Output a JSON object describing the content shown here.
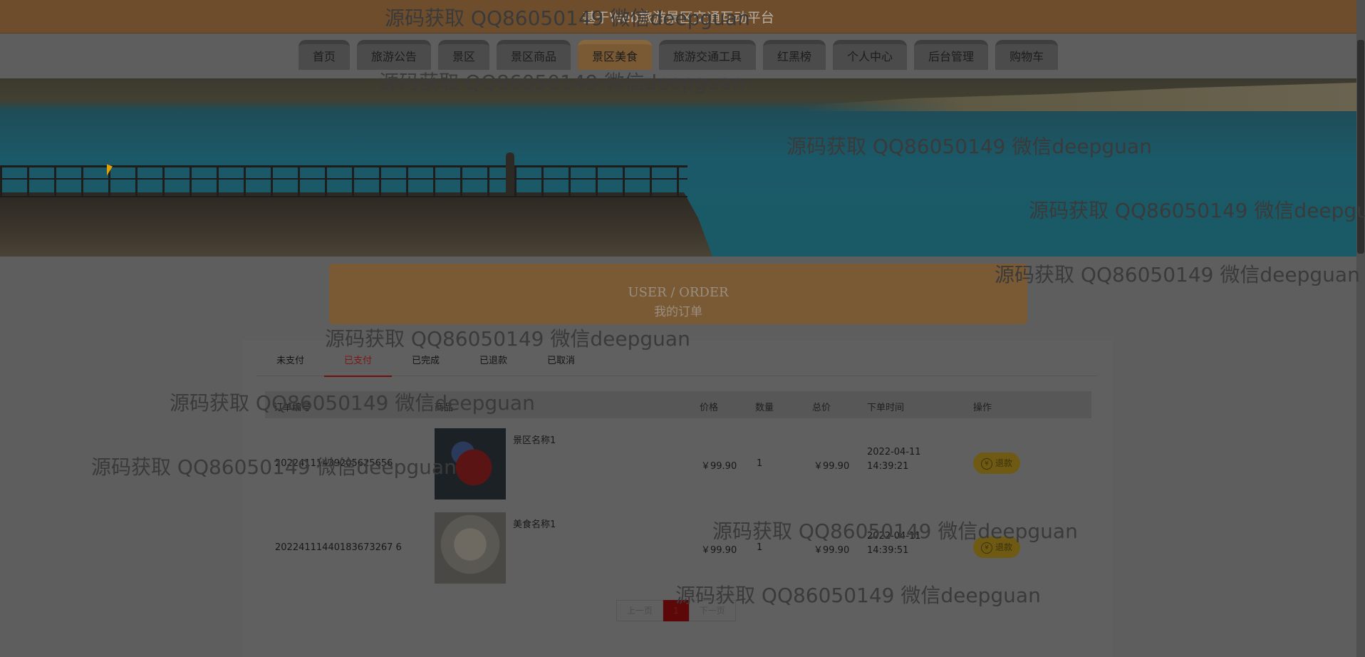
{
  "site_title": "基于Web旅游景区交通互动平台",
  "nav": [
    "首页",
    "旅游公告",
    "景区",
    "景区商品",
    "景区美食",
    "旅游交通工具",
    "红黑榜",
    "个人中心",
    "后台管理",
    "购物车"
  ],
  "nav_active": "景区美食",
  "order_header": {
    "en": "USER / ORDER",
    "zh": "我的订单"
  },
  "tabs": [
    "未支付",
    "已支付",
    "已完成",
    "已退款",
    "已取消"
  ],
  "tab_active": "已支付",
  "columns": [
    "订单编号",
    "商品",
    "价格",
    "数量",
    "总价",
    "下单时间",
    "操作"
  ],
  "orders": [
    {
      "order_no": "20224111439205625656",
      "name": "景区名称1",
      "price": "￥99.90",
      "qty": "1",
      "total": "￥99.90",
      "time_date": "2022-04-11",
      "time_clock": "14:39:21",
      "action": "退款"
    },
    {
      "order_no": "20224111440183673267 6",
      "name": "美食名称1",
      "price": "￥99.90",
      "qty": "1",
      "total": "￥99.90",
      "time_date": "2022-04-11",
      "time_clock": "14:39:51",
      "action": "退款"
    }
  ],
  "pager": {
    "prev": "上一页",
    "current": "1",
    "next": "下一页"
  },
  "watermark": "源码获取 QQ86050149 微信deepguan"
}
